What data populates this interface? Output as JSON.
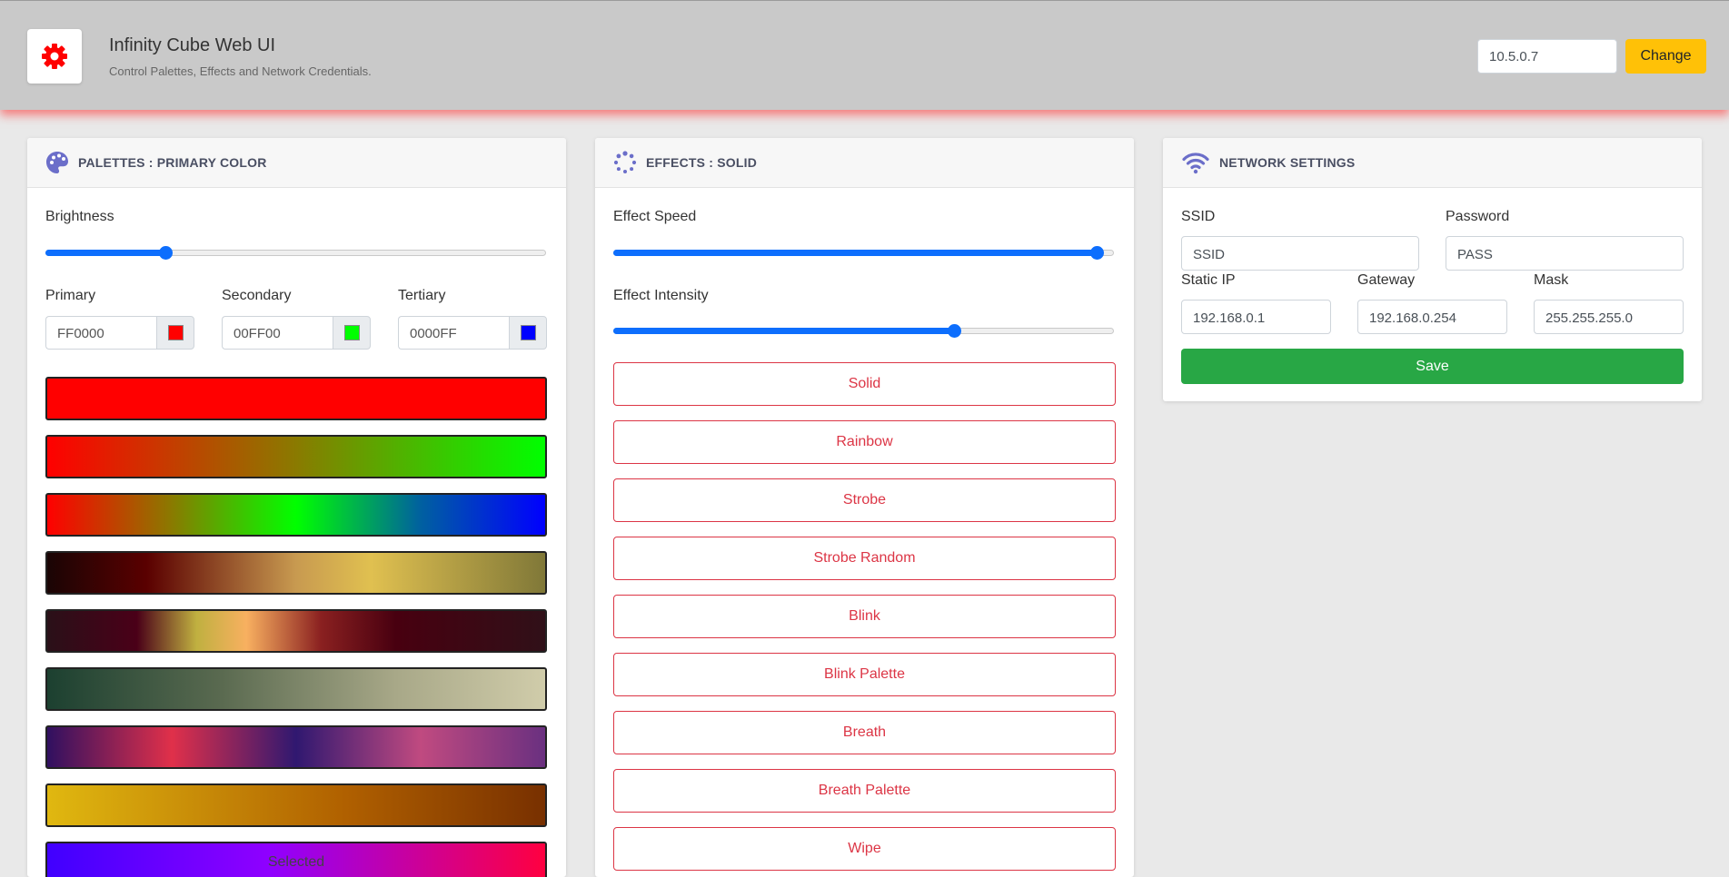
{
  "header": {
    "title": "Infinity Cube Web UI",
    "subtitle": "Control Palettes, Effects and Network Credentials.",
    "ip_value": "10.5.0.7",
    "change_label": "Change",
    "logo_icon": "gear-icon",
    "logo_color": "#ff0000"
  },
  "palettes": {
    "title": "PALETTES : PRIMARY COLOR",
    "icon": "palette-icon",
    "brightness_label": "Brightness",
    "brightness": 0.24,
    "colors": [
      {
        "label": "Primary",
        "hex": "FF0000",
        "swatch": "#ff0000"
      },
      {
        "label": "Secondary",
        "hex": "00FF00",
        "swatch": "#00ff00"
      },
      {
        "label": "Tertiary",
        "hex": "0000FF",
        "swatch": "#0000ff"
      }
    ],
    "selected_label": "Selected"
  },
  "effects": {
    "title": "EFFECTS : SOLID",
    "icon": "spinner-icon",
    "speed_label": "Effect Speed",
    "speed": 0.965,
    "intensity_label": "Effect Intensity",
    "intensity": 0.68,
    "buttons": [
      "Solid",
      "Rainbow",
      "Strobe",
      "Strobe Random",
      "Blink",
      "Blink Palette",
      "Breath",
      "Breath Palette",
      "Wipe"
    ]
  },
  "network": {
    "title": "NETWORK SETTINGS",
    "icon": "wifi-icon",
    "ssid_label": "SSID",
    "ssid_value": "SSID",
    "password_label": "Password",
    "password_value": "PASS",
    "static_ip_label": "Static IP",
    "static_ip_value": "192.168.0.1",
    "gateway_label": "Gateway",
    "gateway_value": "192.168.0.254",
    "mask_label": "Mask",
    "mask_value": "255.255.255.0",
    "save_label": "Save"
  }
}
